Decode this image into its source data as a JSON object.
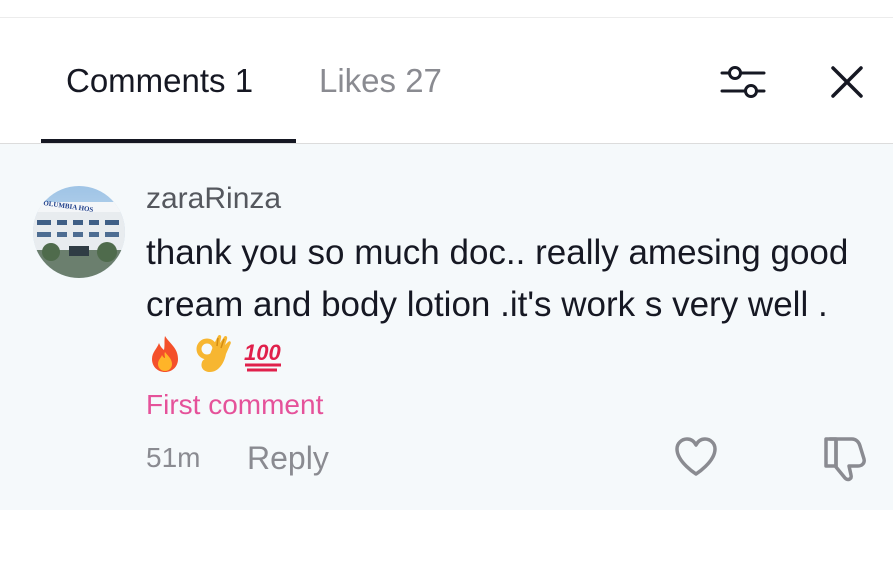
{
  "tabs": {
    "comments_label": "Comments 1",
    "likes_label": "Likes 27",
    "active_tab": "comments"
  },
  "header": {
    "filter_icon": "sliders-icon",
    "close_icon": "close-icon"
  },
  "comment": {
    "username": "zaraRinza",
    "text": "thank you so much doc.. really amesing good cream and body lotion .it's work s very well .",
    "emojis": [
      "fire-emoji",
      "ok-hand-emoji",
      "hundred-points-emoji"
    ],
    "badge": "First comment",
    "time": "51m",
    "reply_label": "Reply",
    "avatar_sign_text": "OLUMBIA HOS",
    "like_icon": "heart-outline-icon",
    "dislike_icon": "thumbs-down-icon"
  },
  "colors": {
    "text_primary": "#161823",
    "text_secondary": "#8a8b91",
    "accent_pink": "#e5529a",
    "comment_background": "#f5f9fb"
  }
}
